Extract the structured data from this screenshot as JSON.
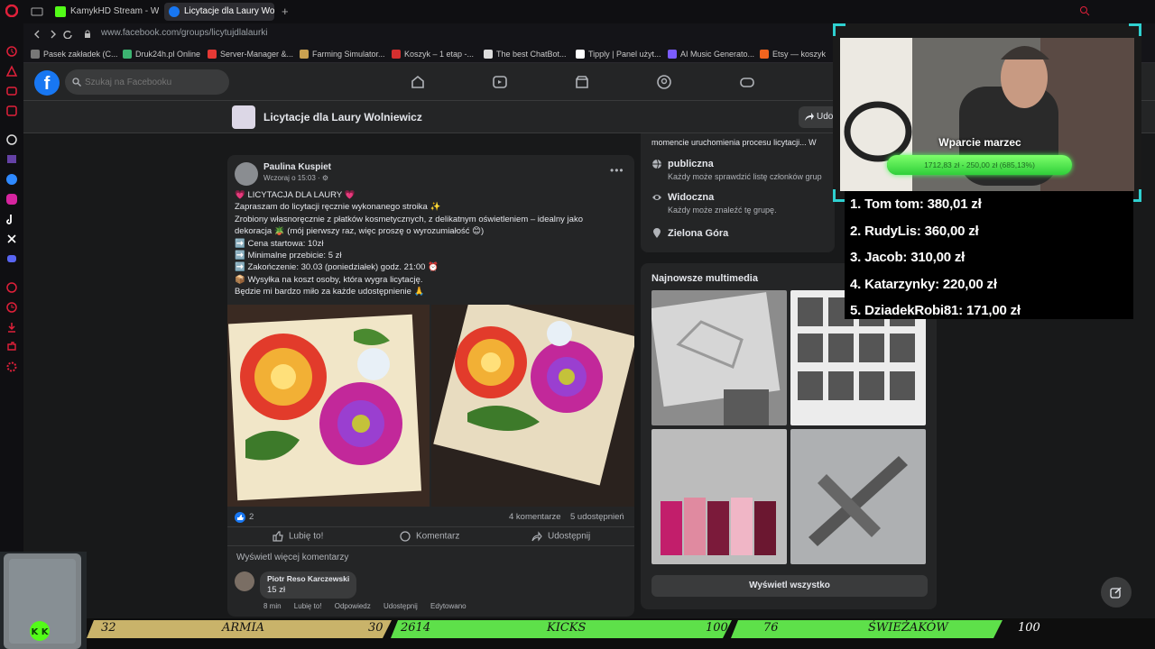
{
  "browser": {
    "tabs": [
      {
        "label": "KamykHD Stream - W"
      },
      {
        "label": "Licytacje dla Laury Wolnie"
      }
    ],
    "new_tab_symbol": "+",
    "address": "www.facebook.com/groups/licytujdlalaurki",
    "bookmarks": [
      {
        "label": "Pasek zakładek (C..."
      },
      {
        "label": "Druk24h.pl Online"
      },
      {
        "label": "Server-Manager &..."
      },
      {
        "label": "Farming Simulator..."
      },
      {
        "label": "Koszyk – 1 etap -..."
      },
      {
        "label": "The best ChatBot..."
      },
      {
        "label": "Tipply | Panel użyt..."
      },
      {
        "label": "AI Music Generato..."
      },
      {
        "label": "Etsy — koszyk"
      }
    ]
  },
  "facebook": {
    "logo": "f",
    "search_placeholder": "Szukaj na Facebooku",
    "nav_icons": [
      "home-icon",
      "video-icon",
      "marketplace-icon",
      "groups-icon",
      "gaming-icon"
    ],
    "group": {
      "name": "Licytacje dla Laury Wolniewicz",
      "share_label": "Udo"
    },
    "post": {
      "author": "Paulina Kuspiet",
      "time": "Wczoraj o 15:03 · ⚙",
      "more": "•••",
      "lines": [
        "💗 LICYTACJA DLA LAURY 💗",
        "Zapraszam do licytacji ręcznie wykonanego stroika ✨",
        "Zrobiony własnoręcznie z płatków kosmetycznych, z delikatnym oświetleniem – idealny jako",
        "dekoracja 🪴 (mój pierwszy raz, więc proszę o wyrozumiałość 😊)",
        "➡️ Cena startowa: 10zł",
        "➡️ Minimalne przebicie: 5 zł",
        "➡️ Zakończenie: 30.03 (poniedziałek) godz. 21:00 ⏰",
        "📦 Wysyłka na koszt osoby, która wygra licytację.",
        "Będzie mi bardzo miło za każde udostępnienie 🙏"
      ],
      "reactions_count": "2",
      "comments_count": "4 komentarze",
      "shares_count": "5 udostępnień",
      "like_label": "Lubię to!",
      "comment_label": "Komentarz",
      "share_label": "Udostępnij",
      "more_comments": "Wyświetl więcej komentarzy",
      "comment": {
        "author": "Piotr Reso Karczewski",
        "text": "15 zł",
        "time": "8 min",
        "like": "Lubię to!",
        "reply": "Odpowiedz",
        "share": "Udostępnij",
        "edited": "Edytowano"
      }
    },
    "about": {
      "intro_text": "momencie uruchomienia procesu licytacji... W",
      "public_title": "publiczna",
      "public_desc": "Każdy może sprawdzić listę członków grup",
      "visible_title": "Widoczna",
      "visible_desc": "Każdy może znaleźć tę grupę.",
      "location": "Zielona Góra"
    },
    "media": {
      "title": "Najnowsze multimedia",
      "see_all": "Wyświetl wszystko"
    }
  },
  "stream": {
    "goal_title": "Wparcie marzec",
    "goal_amount": "1712,83 zł - 250,00 zł (685,13%)",
    "goal_progress": 1.0,
    "donors": [
      {
        "text": "1. Tom tom: 380,01 zł"
      },
      {
        "text": "2. RudyLis: 360,00 zł"
      },
      {
        "text": "3. Jacob: 310,00 zł"
      },
      {
        "text": "4. Katarzynky: 220,00 zł"
      },
      {
        "text": "5. DziadekRobi81: 171,00 zł"
      }
    ],
    "bottom": {
      "armia_value": "32",
      "armia_label": "ARMIA",
      "armia_goal": "30",
      "kicks_value": "2614",
      "kicks_label": "KICKS",
      "kicks_goal": "100",
      "swiezakow_value": "76",
      "swiezakow_label": "ŚWIEŻAKÓW",
      "swiezakow_goal": "100"
    }
  },
  "colors": {
    "fb_blue": "#1877f2",
    "bar_green": "#5ee04a",
    "bar_gold": "#c9b36a",
    "opera_red": "#e0203a"
  }
}
